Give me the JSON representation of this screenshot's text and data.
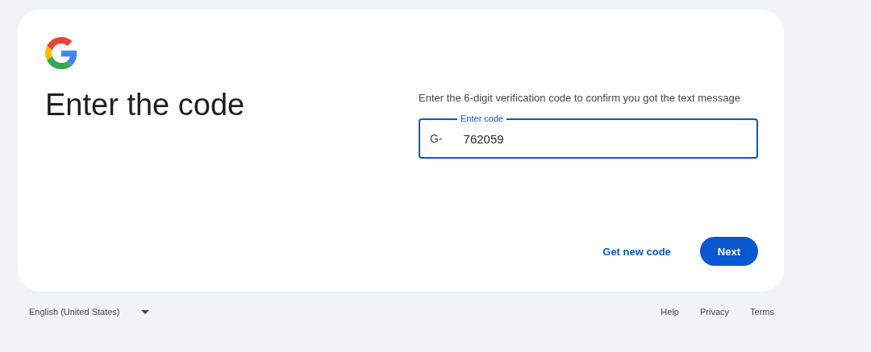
{
  "card": {
    "heading": "Enter the code",
    "description": "Enter the 6-digit verification code to confirm you got the text message",
    "code_field": {
      "label": "Enter code",
      "prefix": "G-",
      "value": "762059",
      "focused": true
    },
    "actions": [
      {
        "label": "Get new code",
        "kind": "text"
      },
      {
        "label": "Next",
        "kind": "filled"
      }
    ]
  },
  "footer": {
    "language": "English (United States)",
    "links": [
      "Help",
      "Privacy",
      "Terms"
    ]
  }
}
